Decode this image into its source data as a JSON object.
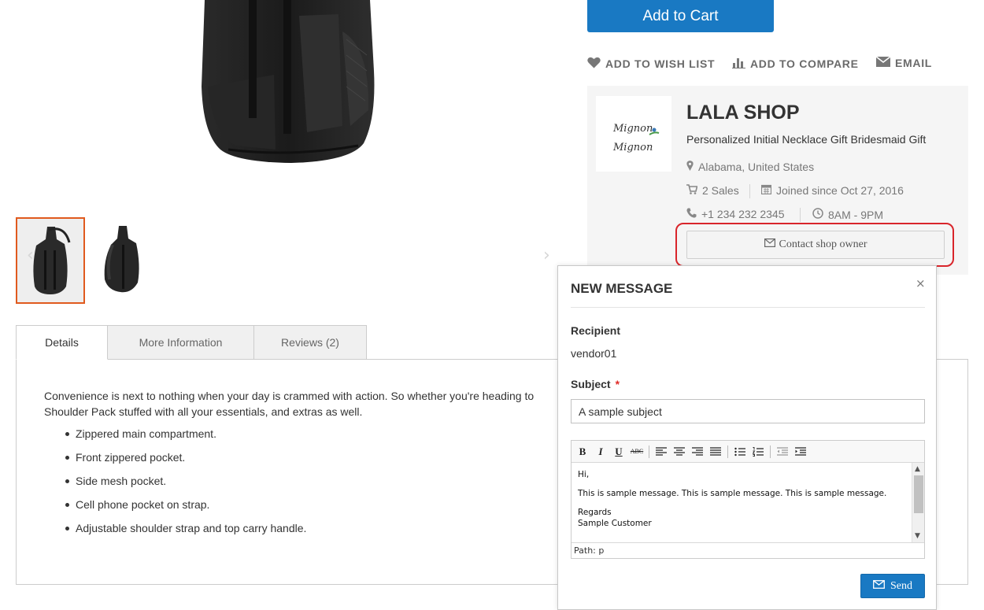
{
  "product": {
    "add_to_cart_label": "Add to Cart",
    "actions": {
      "wishlist": "ADD TO WISH LIST",
      "compare": "ADD TO COMPARE",
      "email": "EMAIL"
    }
  },
  "vendor": {
    "logo_text_line1": "Mignon",
    "logo_text_line2": "Mignon",
    "shop_name": "LALA SHOP",
    "tagline": "Personalized Initial Necklace Gift Bridesmaid Gift",
    "location": "Alabama, United States",
    "sales": "2 Sales",
    "joined": "Joined since Oct 27, 2016",
    "phone": "+1 234 232 2345",
    "hours": "8AM - 9PM",
    "contact_label": "Contact shop owner"
  },
  "tabs": [
    {
      "label": "Details"
    },
    {
      "label": "More Information"
    },
    {
      "label": "Reviews (2)"
    }
  ],
  "details": {
    "description_line1": "Convenience is next to nothing when your day is crammed with action. So whether you're heading to",
    "description_line2": "Shoulder Pack stuffed with all your essentials, and extras as well.",
    "features": [
      "Zippered main compartment.",
      "Front zippered pocket.",
      "Side mesh pocket.",
      "Cell phone pocket on strap.",
      "Adjustable shoulder strap and top carry handle."
    ]
  },
  "modal": {
    "title": "NEW MESSAGE",
    "close_glyph": "×",
    "recipient_label": "Recipient",
    "recipient_value": "vendor01",
    "subject_label": "Subject",
    "required_mark": "*",
    "subject_value": "A sample subject",
    "editor": {
      "toolbar": [
        "B",
        "I",
        "U",
        "ABC"
      ],
      "body_lines": {
        "greeting": "Hi,",
        "message": "This is sample message. This is sample message. This is sample message.",
        "regards": "Regards",
        "signature": "Sample Customer"
      },
      "path": "Path: p"
    },
    "send_label": "Send"
  },
  "colors": {
    "primary": "#1979c3",
    "highlight": "#d9252b",
    "thumb_active_border": "#e05a1e"
  }
}
